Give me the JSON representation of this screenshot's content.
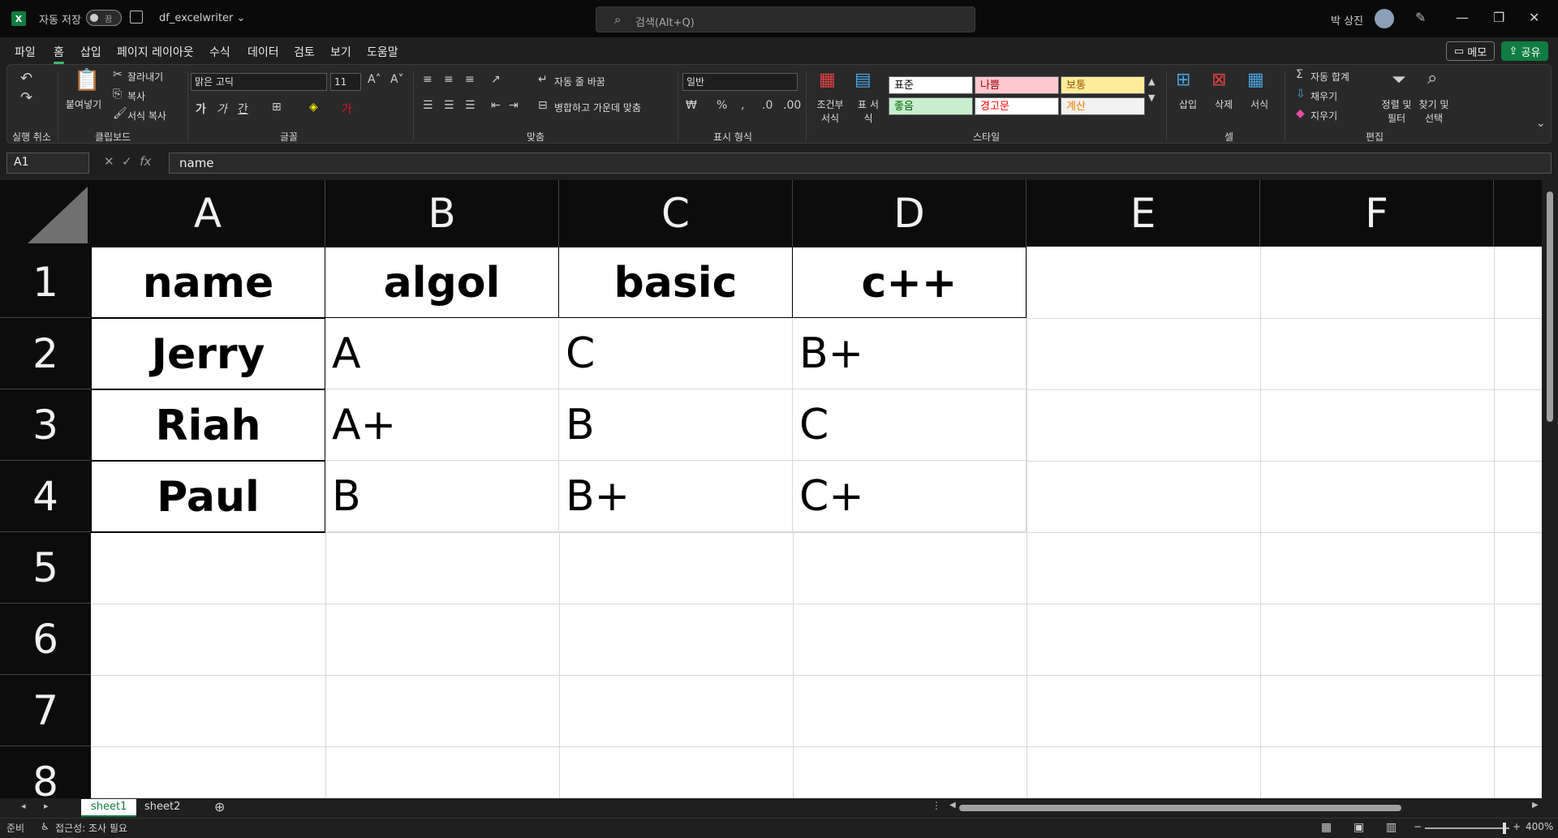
{
  "title_bar": {
    "app_icon": "X",
    "autosave_label": "자동 저장",
    "autosave_state": "끔",
    "filename": "df_excelwriter",
    "search_placeholder": "검색(Alt+Q)",
    "user_name": "박 상진"
  },
  "menu": {
    "items": [
      "파일",
      "홈",
      "삽입",
      "페이지 레이아웃",
      "수식",
      "데이터",
      "검토",
      "보기",
      "도움말"
    ],
    "active": "홈",
    "memo_label": "메모",
    "share_label": "공유"
  },
  "ribbon": {
    "groups": [
      "실행 취소",
      "클립보드",
      "글꼴",
      "맞춤",
      "표시 형식",
      "스타일",
      "셀",
      "편집"
    ],
    "clipboard": {
      "paste": "붙여넣기",
      "cut": "잘라내기",
      "copy": "복사",
      "format_painter": "서식 복사"
    },
    "font": {
      "name": "맑은 고딕",
      "size": "11"
    },
    "alignment": {
      "wrap_text": "자동 줄 바꿈",
      "merge_center": "병합하고 가운데 맞춤"
    },
    "number": {
      "format": "일반"
    },
    "styles": {
      "conditional": "조건부 서식",
      "format_table": "표 서식",
      "cells": [
        {
          "label": "표준",
          "bg": "#ffffff",
          "fg": "#000000"
        },
        {
          "label": "나쁨",
          "bg": "#ffc7ce",
          "fg": "#9c0006"
        },
        {
          "label": "보통",
          "bg": "#ffeb9c",
          "fg": "#9c5700"
        },
        {
          "label": "좋음",
          "bg": "#c6efce",
          "fg": "#006100"
        },
        {
          "label": "경고문",
          "bg": "#ffffff",
          "fg": "#ff0000"
        },
        {
          "label": "계산",
          "bg": "#f2f2f2",
          "fg": "#fa7d00"
        }
      ]
    },
    "cells_group": {
      "insert": "삽입",
      "delete": "삭제",
      "format": "서식"
    },
    "editing": {
      "autosum": "자동 합계",
      "fill": "채우기",
      "clear": "지우기",
      "sort_filter": "정렬 및 필터",
      "find_select": "찾기 및 선택"
    }
  },
  "formula_bar": {
    "name_box": "A1",
    "fx": "fx",
    "value": "name"
  },
  "grid": {
    "columns": [
      "A",
      "B",
      "C",
      "D",
      "E",
      "F"
    ],
    "rows": [
      "1",
      "2",
      "3",
      "4",
      "5",
      "6",
      "7",
      "8"
    ],
    "header_row": [
      "name",
      "algol",
      "basic",
      "c++"
    ],
    "data": [
      [
        "Jerry",
        "A",
        "C",
        "B+"
      ],
      [
        "Riah",
        "A+",
        "B",
        "C"
      ],
      [
        "Paul",
        "B",
        "B+",
        "C+"
      ]
    ]
  },
  "sheets": {
    "tabs": [
      "sheet1",
      "sheet2"
    ],
    "active": "sheet1"
  },
  "status": {
    "ready": "준비",
    "accessibility": "접근성: 조사 필요",
    "zoom": "400%"
  },
  "colors": {
    "accent": "#107c41",
    "header_bg": "#0c0c0c"
  }
}
